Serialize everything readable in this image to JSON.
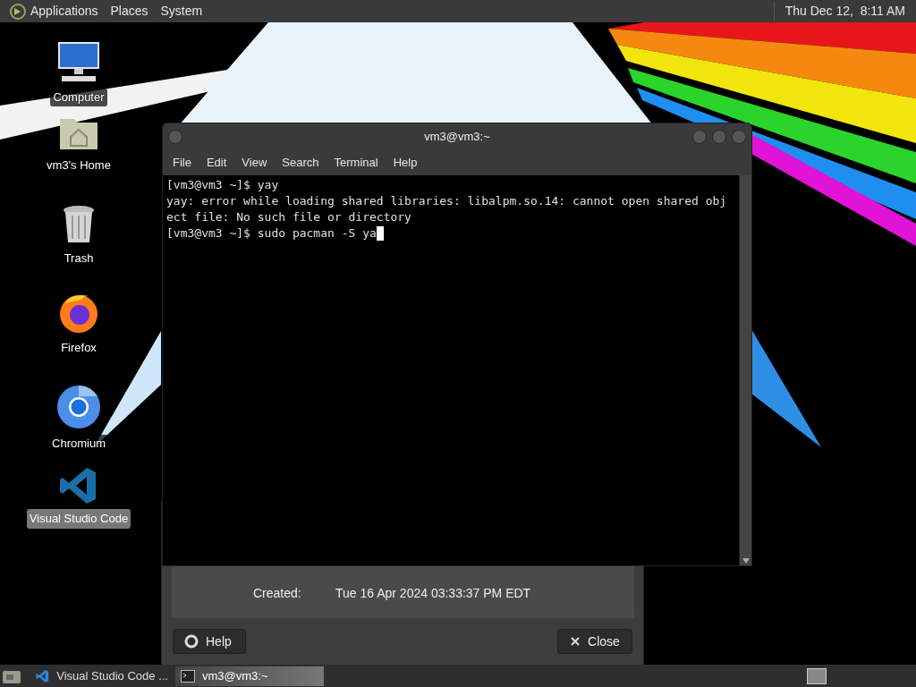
{
  "top_panel": {
    "menus": [
      "Applications",
      "Places",
      "System"
    ],
    "clock": "Thu Dec 12,  8:11 AM"
  },
  "desktop_icons": [
    {
      "kind": "computer",
      "label": "Computer",
      "selected": false
    },
    {
      "kind": "home",
      "label": "vm3's Home",
      "selected": false
    },
    {
      "kind": "trash",
      "label": "Trash",
      "selected": false
    },
    {
      "kind": "firefox",
      "label": "Firefox",
      "selected": false
    },
    {
      "kind": "chromium",
      "label": "Chromium",
      "selected": false
    },
    {
      "kind": "vscode",
      "label": "Visual Studio Code",
      "selected": true
    }
  ],
  "properties_dialog": {
    "rows": [
      {
        "label": "Created:",
        "value": "Tue 16 Apr 2024 03:33:37 PM EDT"
      }
    ],
    "buttons": [
      {
        "kind": "help",
        "label": "Help"
      },
      {
        "kind": "close",
        "label": "Close"
      }
    ]
  },
  "terminal": {
    "title": "vm3@vm3:~",
    "menus": [
      "File",
      "Edit",
      "View",
      "Search",
      "Terminal",
      "Help"
    ],
    "lines": [
      "[vm3@vm3 ~]$ yay",
      "yay: error while loading shared libraries: libalpm.so.14: cannot open shared obj",
      "ect file: No such file or directory",
      "[vm3@vm3 ~]$ sudo pacman -S ya"
    ]
  },
  "taskbar": {
    "items": [
      {
        "kind": "vscode",
        "label": "Visual Studio Code ...",
        "selected": false
      },
      {
        "kind": "terminal",
        "label": "vm3@vm3:~",
        "selected": true
      }
    ]
  }
}
